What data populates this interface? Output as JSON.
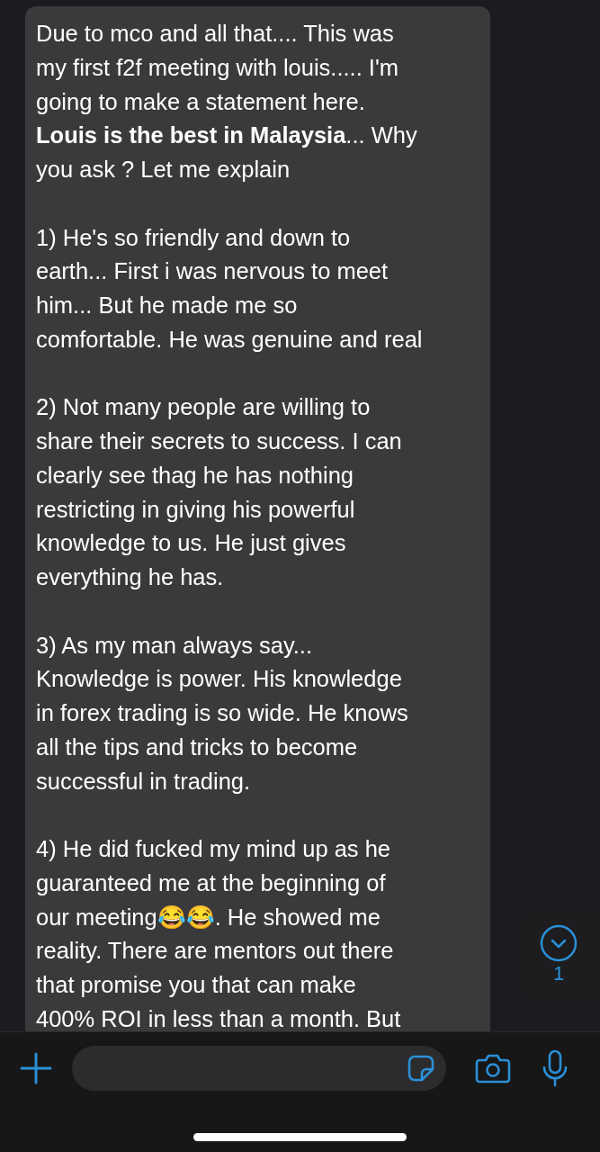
{
  "message": {
    "paragraphs": [
      {
        "lines": [
          "Due to mco and all that.... This was",
          "my first f2f meeting with louis..... I'm",
          "going to make a statement here.",
          "**Louis is the best in Malaysia**... Why",
          "you ask ? Let me explain"
        ]
      },
      {
        "lines": [
          "1) He's so friendly and down to",
          "earth... First i was nervous to meet",
          "him... But he made me so",
          "comfortable. He was genuine and real"
        ]
      },
      {
        "lines": [
          "2) Not many people are willing to",
          "share their secrets to success. I can",
          "clearly see thag he has nothing",
          "restricting in giving his powerful",
          "knowledge to us. He just gives",
          "everything he has."
        ]
      },
      {
        "lines": [
          "3) As my man always say...",
          "Knowledge is power. His knowledge",
          "in forex trading is so wide. He knows",
          "all the tips and tricks to become",
          "successful in trading."
        ]
      },
      {
        "lines": [
          "4) He did fucked my mind up as he",
          "guaranteed me at the beginning of",
          "our meeting😂😂. He showed me",
          "reality. There are mentors out there",
          "that promise you that can make",
          "400% ROI in less than a month. But"
        ]
      }
    ]
  },
  "scroll_button": {
    "unread_count": "1"
  }
}
